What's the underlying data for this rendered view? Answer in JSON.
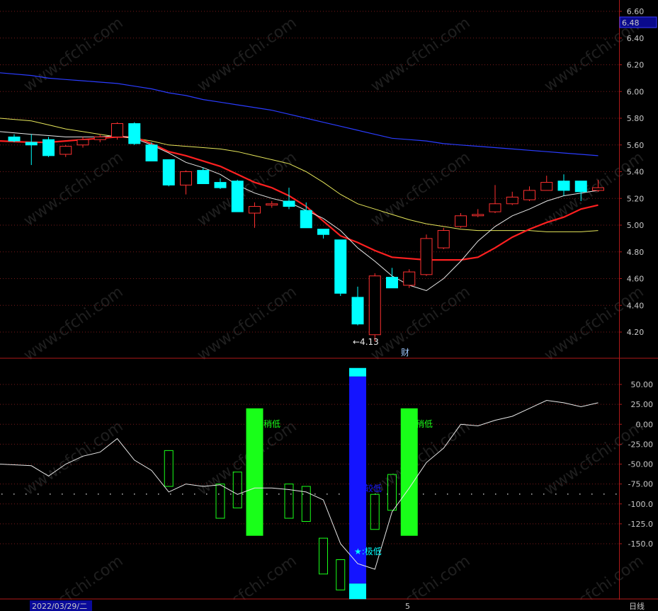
{
  "colors": {
    "background": "#000000",
    "up": "#ff3030",
    "down": "#00ffff",
    "grid": "#7a1a1a",
    "border": "#b01818",
    "ma_white": "#e8e8e8",
    "ma_red": "#ff2020",
    "ma_yellow": "#e6e65a",
    "ma_blue": "#2a3cff",
    "osc_line": "#e8e8e8",
    "osc_green": "#19ff19",
    "osc_blue": "#1414ff",
    "osc_cyan": "#00ffff",
    "axis_text": "#c8c8c8"
  },
  "watermark": "www.cfchi.com",
  "price_axis": {
    "ticks": [
      "6.60",
      "6.40",
      "6.20",
      "6.00",
      "5.80",
      "5.60",
      "5.40",
      "5.20",
      "5.00",
      "4.80",
      "4.60",
      "4.40",
      "4.20"
    ],
    "current_price": "6.48"
  },
  "osc_axis": {
    "ticks": [
      "50.00",
      "25.00",
      "0.00",
      "-25.00",
      "-50.00",
      "-75.00",
      "-100.0",
      "-125.0",
      "-150.0"
    ]
  },
  "annotations": {
    "low_label": "←4.13",
    "finance_marker": "财",
    "label_slight_low_1": "稍低",
    "label_slight_low_2": "稍低",
    "label_mid_low": "较低",
    "label_extreme_low": "★:极低"
  },
  "bottom_bar": {
    "date": "2022/03/29/二",
    "month_marker": "5",
    "period": "日线"
  },
  "chart_data": [
    {
      "type": "candlestick",
      "ylim": [
        4.05,
        6.65
      ],
      "grid": true,
      "candles": [
        {
          "o": 5.66,
          "h": 5.68,
          "l": 5.62,
          "c": 5.63
        },
        {
          "o": 5.62,
          "h": 5.68,
          "l": 5.45,
          "c": 5.6
        },
        {
          "o": 5.64,
          "h": 5.66,
          "l": 5.51,
          "c": 5.52
        },
        {
          "o": 5.53,
          "h": 5.6,
          "l": 5.51,
          "c": 5.59
        },
        {
          "o": 5.6,
          "h": 5.66,
          "l": 5.58,
          "c": 5.64
        },
        {
          "o": 5.64,
          "h": 5.68,
          "l": 5.62,
          "c": 5.66
        },
        {
          "o": 5.66,
          "h": 5.77,
          "l": 5.64,
          "c": 5.76
        },
        {
          "o": 5.76,
          "h": 5.77,
          "l": 5.6,
          "c": 5.61
        },
        {
          "o": 5.6,
          "h": 5.62,
          "l": 5.48,
          "c": 5.48
        },
        {
          "o": 5.49,
          "h": 5.49,
          "l": 5.29,
          "c": 5.3
        },
        {
          "o": 5.3,
          "h": 5.41,
          "l": 5.23,
          "c": 5.4
        },
        {
          "o": 5.41,
          "h": 5.43,
          "l": 5.31,
          "c": 5.31
        },
        {
          "o": 5.32,
          "h": 5.35,
          "l": 5.27,
          "c": 5.28
        },
        {
          "o": 5.33,
          "h": 5.34,
          "l": 5.1,
          "c": 5.1
        },
        {
          "o": 5.09,
          "h": 5.17,
          "l": 4.98,
          "c": 5.14
        },
        {
          "o": 5.15,
          "h": 5.18,
          "l": 5.13,
          "c": 5.16
        },
        {
          "o": 5.18,
          "h": 5.28,
          "l": 5.12,
          "c": 5.14
        },
        {
          "o": 5.11,
          "h": 5.17,
          "l": 4.98,
          "c": 4.98
        },
        {
          "o": 4.97,
          "h": 4.97,
          "l": 4.9,
          "c": 4.93
        },
        {
          "o": 4.89,
          "h": 4.89,
          "l": 4.47,
          "c": 4.49
        },
        {
          "o": 4.46,
          "h": 4.54,
          "l": 4.25,
          "c": 4.26
        },
        {
          "o": 4.18,
          "h": 4.64,
          "l": 4.13,
          "c": 4.62
        },
        {
          "o": 4.61,
          "h": 4.68,
          "l": 4.53,
          "c": 4.53
        },
        {
          "o": 4.55,
          "h": 4.67,
          "l": 4.53,
          "c": 4.65
        },
        {
          "o": 4.63,
          "h": 4.93,
          "l": 4.62,
          "c": 4.9
        },
        {
          "o": 4.83,
          "h": 4.98,
          "l": 4.82,
          "c": 4.96
        },
        {
          "o": 4.99,
          "h": 5.09,
          "l": 4.98,
          "c": 5.07
        },
        {
          "o": 5.07,
          "h": 5.12,
          "l": 5.06,
          "c": 5.08
        },
        {
          "o": 5.1,
          "h": 5.3,
          "l": 5.09,
          "c": 5.16
        },
        {
          "o": 5.16,
          "h": 5.25,
          "l": 5.15,
          "c": 5.21
        },
        {
          "o": 5.19,
          "h": 5.29,
          "l": 5.18,
          "c": 5.26
        },
        {
          "o": 5.26,
          "h": 5.37,
          "l": 5.26,
          "c": 5.32
        },
        {
          "o": 5.33,
          "h": 5.38,
          "l": 5.22,
          "c": 5.26
        },
        {
          "o": 5.33,
          "h": 5.33,
          "l": 5.18,
          "c": 5.25
        },
        {
          "o": 5.26,
          "h": 5.34,
          "l": 5.25,
          "c": 5.28
        }
      ],
      "ma_white": [
        5.7,
        5.68,
        5.67,
        5.66,
        5.66,
        5.66,
        5.67,
        5.65,
        5.6,
        5.54,
        5.47,
        5.43,
        5.38,
        5.3,
        5.24,
        5.2,
        5.17,
        5.11,
        5.05,
        4.96,
        4.83,
        4.73,
        4.62,
        4.55,
        4.51,
        4.6,
        4.73,
        4.88,
        4.99,
        5.07,
        5.12,
        5.18,
        5.22,
        5.24,
        5.26
      ],
      "ma_red": [
        5.63,
        5.62,
        5.62,
        5.63,
        5.64,
        5.65,
        5.66,
        5.66,
        5.61,
        5.55,
        5.52,
        5.48,
        5.44,
        5.38,
        5.32,
        5.28,
        5.22,
        5.14,
        5.03,
        4.92,
        4.87,
        4.81,
        4.76,
        4.75,
        4.74,
        4.74,
        4.74,
        4.76,
        4.83,
        4.91,
        4.97,
        5.02,
        5.06,
        5.12,
        5.15
      ],
      "ma_yellow": [
        5.8,
        5.78,
        5.75,
        5.72,
        5.7,
        5.68,
        5.66,
        5.65,
        5.63,
        5.6,
        5.59,
        5.58,
        5.57,
        5.55,
        5.52,
        5.49,
        5.46,
        5.4,
        5.32,
        5.23,
        5.16,
        5.12,
        5.08,
        5.04,
        5.01,
        4.99,
        4.97,
        4.96,
        4.96,
        4.96,
        4.96,
        4.95,
        4.95,
        4.95,
        4.96
      ],
      "ma_blue": [
        6.14,
        6.12,
        6.1,
        6.09,
        6.08,
        6.07,
        6.06,
        6.04,
        6.02,
        5.99,
        5.97,
        5.94,
        5.92,
        5.9,
        5.88,
        5.86,
        5.83,
        5.8,
        5.77,
        5.74,
        5.71,
        5.68,
        5.65,
        5.64,
        5.63,
        5.61,
        5.6,
        5.59,
        5.58,
        5.57,
        5.56,
        5.55,
        5.54,
        5.53,
        5.52
      ]
    },
    {
      "type": "bar",
      "ylim": [
        -210,
        75
      ],
      "grid": true,
      "line": [
        -50,
        -52,
        -65,
        -50,
        -40,
        -35,
        -18,
        -45,
        -58,
        -85,
        -75,
        -78,
        -76,
        -88,
        -80,
        -80,
        -82,
        -85,
        -95,
        -150,
        -175,
        -182,
        -110,
        -80,
        -48,
        -30,
        0,
        -2,
        5,
        10,
        20,
        30,
        27,
        22,
        27
      ],
      "hollow_bars": [
        {
          "i": 9,
          "top": -33,
          "bottom": -78
        },
        {
          "i": 12,
          "top": -75,
          "bottom": -118
        },
        {
          "i": 13,
          "top": -60,
          "bottom": -105
        },
        {
          "i": 16,
          "top": -75,
          "bottom": -118
        },
        {
          "i": 17,
          "top": -78,
          "bottom": -122
        },
        {
          "i": 18,
          "top": -143,
          "bottom": -188
        },
        {
          "i": 19,
          "top": -170,
          "bottom": -208
        },
        {
          "i": 21,
          "top": -88,
          "bottom": -132
        },
        {
          "i": 22,
          "top": -63,
          "bottom": -108
        }
      ],
      "signal_bars": [
        {
          "i": 14,
          "top": 20,
          "bottom": -140,
          "color": "green"
        },
        {
          "i": 20,
          "top": 60,
          "bottom": -200,
          "color": "blue",
          "cap": true
        },
        {
          "i": 23,
          "top": 20,
          "bottom": -140,
          "color": "green"
        }
      ],
      "dotted_level": -87
    }
  ]
}
